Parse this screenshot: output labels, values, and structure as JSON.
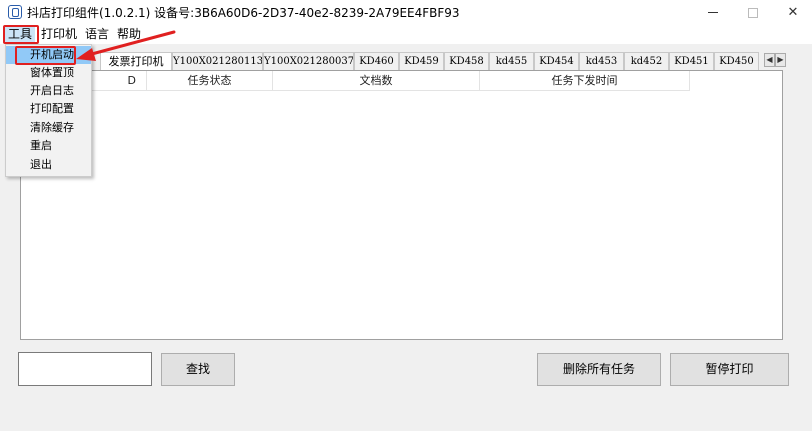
{
  "window": {
    "title": "抖店打印组件(1.0.2.1) 设备号:3B6A60D6-2D37-40e2-8239-2A79EE4FBF93",
    "minimize_glyph": "—",
    "close_glyph": "✕"
  },
  "menubar": {
    "items": [
      {
        "label": "工具"
      },
      {
        "label": "打印机"
      },
      {
        "label": "语言"
      },
      {
        "label": "帮助"
      }
    ]
  },
  "tools_menu": {
    "items": [
      {
        "label": "开机启动"
      },
      {
        "label": "窗体置顶"
      },
      {
        "label": "开启日志"
      },
      {
        "label": "打印配置"
      },
      {
        "label": "清除缓存"
      },
      {
        "label": "重启"
      },
      {
        "label": "退出"
      }
    ]
  },
  "tabs": {
    "items": [
      {
        "label": "发票打印机"
      },
      {
        "label": "Y100X021280113"
      },
      {
        "label": "Y100X021280037"
      },
      {
        "label": "KD460"
      },
      {
        "label": "KD459"
      },
      {
        "label": "KD458"
      },
      {
        "label": "kd455"
      },
      {
        "label": "KD454"
      },
      {
        "label": "kd453"
      },
      {
        "label": "kd452"
      },
      {
        "label": "KD451"
      },
      {
        "label": "KD450"
      }
    ],
    "scroll_left": "◀",
    "scroll_right": "▶"
  },
  "table": {
    "columns": [
      {
        "label": "D"
      },
      {
        "label": "任务状态"
      },
      {
        "label": "文档数"
      },
      {
        "label": "任务下发时间"
      }
    ]
  },
  "controls": {
    "search_value": "",
    "find_label": "查找",
    "delete_all_label": "删除所有任务",
    "pause_label": "暂停打印"
  },
  "colors": {
    "annotation": "#e02020",
    "menu_hover": "#91c9f7",
    "menu_active": "#cce4f7"
  }
}
